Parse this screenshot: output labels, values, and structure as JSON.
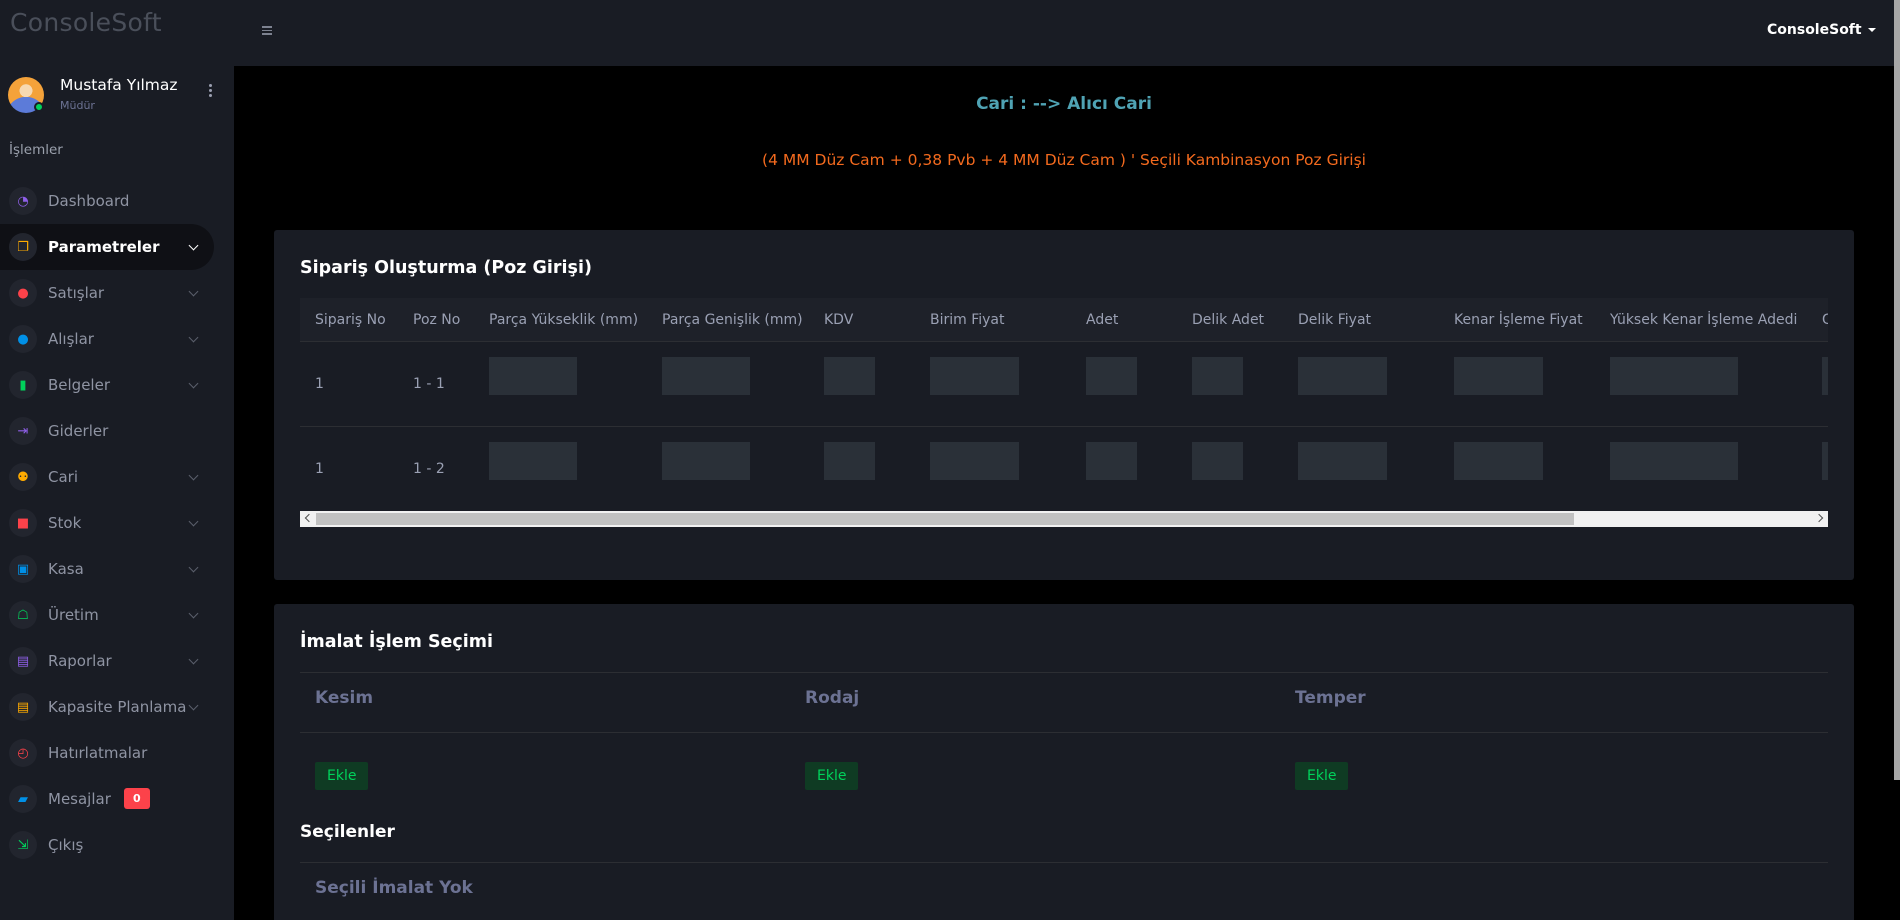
{
  "brand": "ConsoleSoft",
  "profile": {
    "name": "Mustafa Yılmaz",
    "role": "Müdür"
  },
  "sidebar": {
    "section_title": "İşlemler",
    "items": [
      {
        "label": "Dashboard",
        "icon": "speedometer-icon",
        "color": "#8f5fe8",
        "chevron": false
      },
      {
        "label": "Parametreler",
        "icon": "layers-icon",
        "color": "#ffab00",
        "chevron": true
      },
      {
        "label": "Satışlar",
        "icon": "plus-circle-icon",
        "color": "#fc424a",
        "chevron": true
      },
      {
        "label": "Alışlar",
        "icon": "minus-circle-icon",
        "color": "#0090e7",
        "chevron": true
      },
      {
        "label": "Belgeler",
        "icon": "book-icon",
        "color": "#00d25b",
        "chevron": true
      },
      {
        "label": "Giderler",
        "icon": "arrow-right-icon",
        "color": "#8f5fe8",
        "chevron": false
      },
      {
        "label": "Cari",
        "icon": "users-icon",
        "color": "#ffab00",
        "chevron": true
      },
      {
        "label": "Stok",
        "icon": "box-icon",
        "color": "#fc424a",
        "chevron": true
      },
      {
        "label": "Kasa",
        "icon": "cash-icon",
        "color": "#0090e7",
        "chevron": true
      },
      {
        "label": "Üretim",
        "icon": "robot-icon",
        "color": "#00d25b",
        "chevron": true
      },
      {
        "label": "Raporlar",
        "icon": "clipboard-icon",
        "color": "#8f5fe8",
        "chevron": true
      },
      {
        "label": "Kapasite Planlama",
        "icon": "clipboard-list-icon",
        "color": "#ffab00",
        "chevron": true
      },
      {
        "label": "Hatırlatmalar",
        "icon": "alarm-icon",
        "color": "#fc424a",
        "chevron": false
      },
      {
        "label": "Mesajlar",
        "icon": "message-icon",
        "color": "#0090e7",
        "chevron": false,
        "badge": "0"
      },
      {
        "label": "Çıkış",
        "icon": "logout-icon",
        "color": "#00d25b",
        "chevron": false
      }
    ]
  },
  "topbar": {
    "user": "ConsoleSoft"
  },
  "header": {
    "cari": "Cari : --> Alıcı Cari",
    "kombinasyon": "(4 MM Düz Cam + 0,38 Pvb + 4 MM Düz Cam ) ' Seçili Kambinasyon Poz Girişi"
  },
  "order_card": {
    "title": "Sipariş Oluşturma (Poz Girişi)",
    "columns": [
      "Sipariş No",
      "Poz No",
      "Parça Yükseklik (mm)",
      "Parça Genişlik (mm)",
      "KDV",
      "Birim Fiyat",
      "Adet",
      "Delik Adet",
      "Delik Fiyat",
      "Kenar İşleme Fiyat",
      "Yüksek Kenar İşleme Adedi",
      "G"
    ],
    "rows": [
      {
        "siparis_no": "1",
        "poz_no": "1 - 1"
      },
      {
        "siparis_no": "1",
        "poz_no": "1 - 2"
      }
    ]
  },
  "imalat_card": {
    "title": "İmalat İşlem Seçimi",
    "columns": [
      "Kesim",
      "Rodaj",
      "Temper"
    ],
    "add_label": "Ekle",
    "selected_title": "Seçilenler",
    "empty_text": "Seçili İmalat Yok"
  }
}
